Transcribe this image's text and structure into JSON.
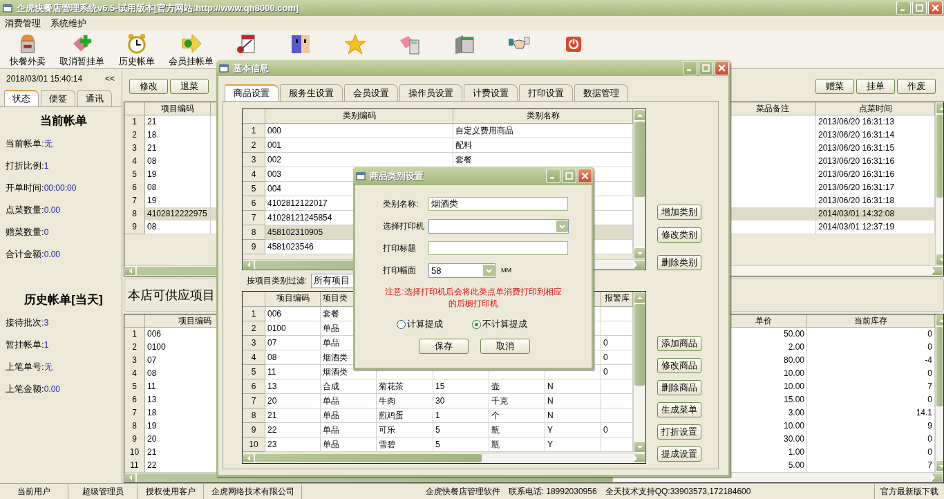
{
  "window": {
    "title": "企虎快餐店管理系统v6.5-试用版本[官方网站:http://www.qh8000.com]"
  },
  "menu": [
    "消费管理",
    "系统维护"
  ],
  "toolbar": [
    {
      "kind": "box",
      "label": "快餐外卖"
    },
    {
      "kind": "card-plus",
      "label": "取消暂挂单"
    },
    {
      "kind": "clock",
      "label": "历史帐单"
    },
    {
      "kind": "arrow",
      "label": "会员挂帐单"
    },
    {
      "kind": "notepad"
    },
    {
      "kind": "face"
    },
    {
      "kind": "star"
    },
    {
      "kind": "calculator"
    },
    {
      "kind": "window"
    },
    {
      "kind": "handshake"
    },
    {
      "kind": "power"
    }
  ],
  "left_panel": {
    "datetime": "2018/03/01 15:40:14",
    "collapse": "<<",
    "tabs": [
      {
        "label": "状态",
        "selected": true
      },
      {
        "label": "便签",
        "selected": false
      },
      {
        "label": "通讯",
        "selected": false
      }
    ],
    "current_bill": {
      "title": "当前帐单",
      "fields": [
        {
          "label": "当前帐单:",
          "value": "无"
        },
        {
          "label": "打折比例:",
          "value": "1"
        },
        {
          "label": "开单时间:",
          "value": "00:00:00"
        },
        {
          "label": "点菜数量:",
          "value": "0.00"
        },
        {
          "label": "赠菜数量:",
          "value": "0"
        },
        {
          "label": "合计金额:",
          "value": "0.00"
        }
      ]
    },
    "history": {
      "title": "历史帐单[当天]",
      "fields": [
        {
          "label": "接待批次:",
          "value": "3"
        },
        {
          "label": "暂挂帐单:",
          "value": "1"
        },
        {
          "label": "上笔单号:",
          "value": "无"
        },
        {
          "label": "上笔金额:",
          "value": "0.00"
        }
      ]
    }
  },
  "bill_actions_left": [
    "修改",
    "退菜"
  ],
  "bill_actions_right": [
    "赠菜",
    "挂单",
    "作废"
  ],
  "order_grid": {
    "columns": [
      "项目编码",
      "菜品备注",
      "点菜时间"
    ],
    "rows": [
      {
        "num": "1",
        "code": "21",
        "time": "2013/06/20 16:31:13",
        "selected": false
      },
      {
        "num": "2",
        "code": "18",
        "time": "2013/06/20 16:31:14",
        "selected": false
      },
      {
        "num": "3",
        "code": "21",
        "time": "2013/06/20 16:31:15",
        "selected": false
      },
      {
        "num": "4",
        "code": "08",
        "time": "2013/06/20 16:31:16",
        "selected": false
      },
      {
        "num": "5",
        "code": "19",
        "time": "2013/06/20 16:31:16",
        "selected": false
      },
      {
        "num": "6",
        "code": "08",
        "time": "2013/06/20 16:31:17",
        "selected": false
      },
      {
        "num": "7",
        "code": "19",
        "time": "2013/06/20 16:31:18",
        "selected": false
      },
      {
        "num": "8",
        "code": "4102812222975",
        "time": "2014/03/01 14:32:08",
        "selected": true
      },
      {
        "num": "9",
        "code": "08",
        "time": "2014/03/01 12:37:19",
        "selected": false
      }
    ]
  },
  "menu_items_title": "本店可供应项目",
  "menu_grid": {
    "columns": [
      "项目编码",
      "单价",
      "当前库存"
    ],
    "rows": [
      {
        "num": "1",
        "code": "006",
        "price": "50.00",
        "stock": "0"
      },
      {
        "num": "2",
        "code": "0100",
        "price": "2.00",
        "stock": "0"
      },
      {
        "num": "3",
        "code": "07",
        "price": "80.00",
        "stock": "-4"
      },
      {
        "num": "4",
        "code": "08",
        "price": "10.00",
        "stock": "0"
      },
      {
        "num": "5",
        "code": "11",
        "price": "10.00",
        "stock": "7"
      },
      {
        "num": "6",
        "code": "13",
        "price": "15.00",
        "stock": "0"
      },
      {
        "num": "7",
        "code": "18",
        "price": "3.00",
        "stock": "14.1"
      },
      {
        "num": "8",
        "code": "19",
        "price": "10.00",
        "stock": "9"
      },
      {
        "num": "9",
        "code": "20",
        "price": "30.00",
        "stock": "0"
      },
      {
        "num": "10",
        "code": "21",
        "price": "1.00",
        "stock": "0"
      },
      {
        "num": "11",
        "code": "22",
        "price": "5.00",
        "stock": "7"
      }
    ]
  },
  "status_bar": [
    {
      "texts": [
        "当前用户"
      ]
    },
    {
      "texts": [
        "超级管理员"
      ]
    },
    {
      "texts": [
        "授权使用客户"
      ]
    },
    {
      "texts": [
        "企虎网络技术有限公司"
      ]
    },
    {
      "texts": [
        "企虎快餐店管理软件",
        "联系电话: 18992030956",
        "全天技术支持QQ:33903573,172184600"
      ]
    },
    {
      "texts": [
        "官方最新版下载"
      ]
    }
  ],
  "base_dialog": {
    "title": "基本信息",
    "tabs": [
      {
        "label": "商品设置",
        "selected": true
      },
      {
        "label": "服务生设置",
        "selected": false
      },
      {
        "label": "会员设置",
        "selected": false
      },
      {
        "label": "操作员设置",
        "selected": false
      },
      {
        "label": "计费设置",
        "selected": false
      },
      {
        "label": "打印设置",
        "selected": false
      },
      {
        "label": "数据管理",
        "selected": false
      }
    ],
    "category_grid": {
      "columns": [
        "类别编码",
        "类别名称"
      ],
      "rows": [
        {
          "num": "1",
          "code": "000",
          "name": "自定义费用商品",
          "selected": false
        },
        {
          "num": "2",
          "code": "001",
          "name": "配料",
          "selected": false
        },
        {
          "num": "3",
          "code": "002",
          "name": "套餐",
          "selected": false
        },
        {
          "num": "4",
          "code": "003",
          "selected": false
        },
        {
          "num": "5",
          "code": "004",
          "selected": false
        },
        {
          "num": "6",
          "code": "4102812122017",
          "selected": false
        },
        {
          "num": "7",
          "code": "41028121245854",
          "selected": false
        },
        {
          "num": "8",
          "code": "458102310905",
          "selected": true
        },
        {
          "num": "9",
          "code": "4581023546",
          "selected": false
        }
      ]
    },
    "category_buttons": [
      "增加类别",
      "修改类别",
      "删除类别"
    ],
    "filter": {
      "label": "按项目类别过滤:",
      "value": "所有项目"
    },
    "product_grid": {
      "columns": [
        "项目编码",
        "项目类",
        "报警库"
      ],
      "rows": [
        {
          "num": "1",
          "code": "006",
          "type": "套餐"
        },
        {
          "num": "2",
          "code": "0100",
          "type": "单品"
        },
        {
          "num": "3",
          "code": "07",
          "type": "单品",
          "alarm": "0"
        },
        {
          "num": "4",
          "code": "08",
          "type": "烟酒类",
          "alarm": "0"
        },
        {
          "num": "5",
          "code": "11",
          "type": "烟酒类",
          "alarm": "0"
        },
        {
          "num": "6",
          "code": "13",
          "type": "合成",
          "name": "菊花茶",
          "qty": "15",
          "unit": "壶",
          "flag": "N"
        },
        {
          "num": "7",
          "code": "20",
          "type": "单品",
          "name": "牛肉",
          "qty": "30",
          "unit": "千克",
          "flag": "N"
        },
        {
          "num": "8",
          "code": "21",
          "type": "单品",
          "name": "煎鸡蛋",
          "qty": "1",
          "unit": "个",
          "flag": "N"
        },
        {
          "num": "9",
          "code": "22",
          "type": "单品",
          "name": "可乐",
          "qty": "5",
          "unit": "瓶",
          "flag": "Y",
          "alarm": "0"
        },
        {
          "num": "10",
          "code": "23",
          "type": "单品",
          "name": "雪碧",
          "qty": "5",
          "unit": "瓶",
          "flag": "Y"
        }
      ]
    },
    "product_buttons": [
      "添加商品",
      "修改商品",
      "删除商品",
      "生成菜单",
      "打折设置",
      "提成设置"
    ]
  },
  "category_dialog": {
    "title": "商品类别设置",
    "fields": [
      {
        "kind": "text",
        "label": "类别名称:",
        "value": "烟酒类"
      },
      {
        "kind": "select",
        "label": "选择打印机"
      },
      {
        "kind": "text",
        "label": "打印标题"
      },
      {
        "kind": "select",
        "label": "打印幅面",
        "value": "58",
        "unit": "MM"
      }
    ],
    "note": "注意:选择打印机后会将此类点单消费打印到相应的后橱打印机",
    "radios": [
      {
        "label": "计算提成",
        "selected": false
      },
      {
        "label": "不计算提成",
        "selected": true
      }
    ],
    "buttons": [
      "保存",
      "取消"
    ]
  }
}
